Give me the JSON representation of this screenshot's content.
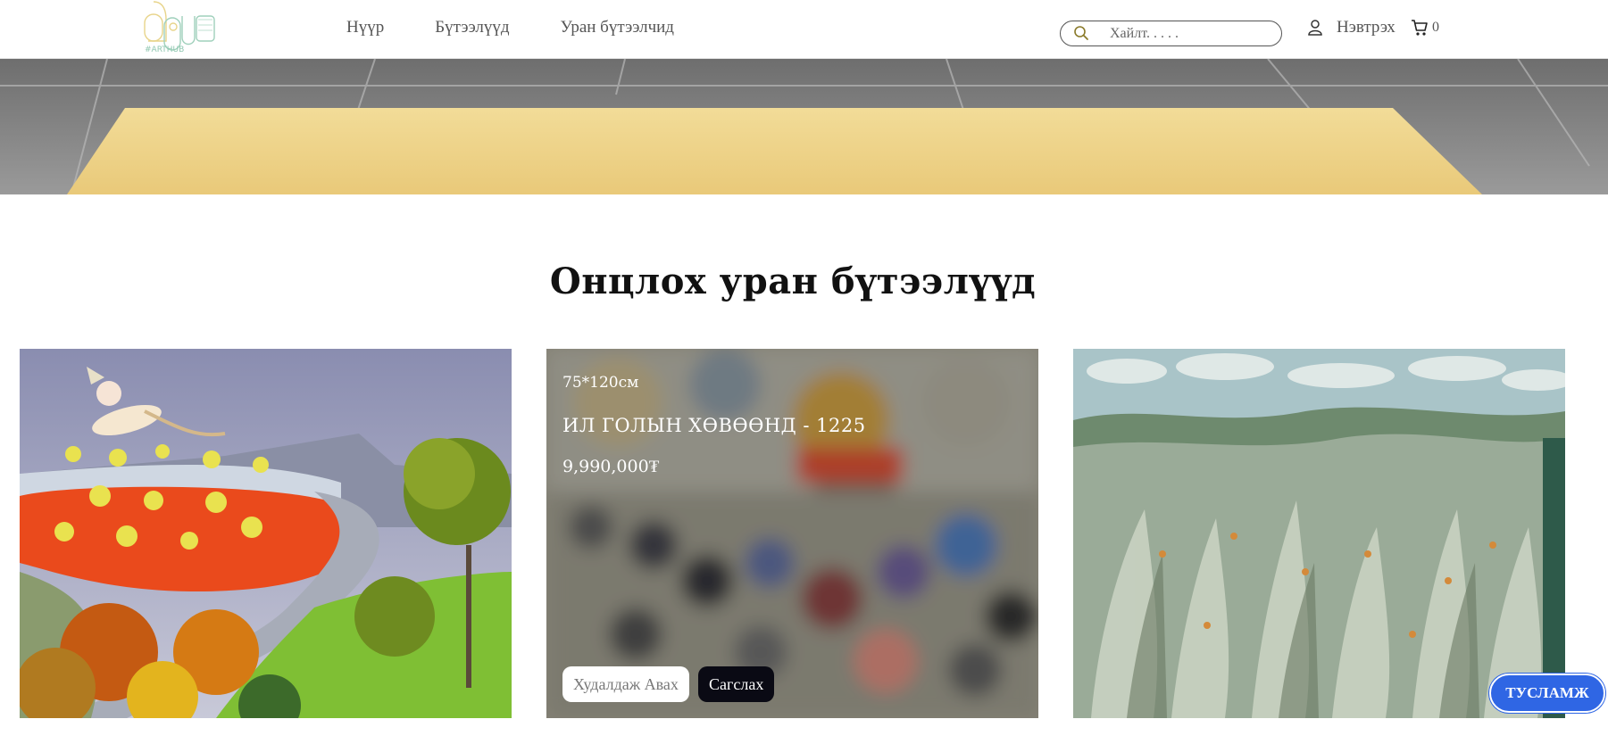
{
  "header": {
    "logo_text": "#ARTHUB",
    "nav": [
      {
        "label": "Нүүр"
      },
      {
        "label": "Бүтээлүүд"
      },
      {
        "label": "Уран бүтээлчид"
      }
    ],
    "search": {
      "placeholder": "Хайлт. . . . ."
    },
    "login_label": "Нэвтрэх",
    "cart_count": "0"
  },
  "section": {
    "title": "Онцлох уран бүтээлүүд"
  },
  "cards": [
    {
      "image": "landscape-painting-river"
    },
    {
      "image": "painting-festival-blurred",
      "size": "75*120см",
      "title": "ИЛ ГОЛЫН ХӨВӨӨНД - 1225",
      "price": "9,990,000₮",
      "buy_label": "Худалдаж Авах",
      "save_label": "Сагслах"
    },
    {
      "image": "abstract-painting-figures"
    }
  ],
  "help_label": "ТУСЛАМЖ",
  "colors": {
    "accent": "#2f66e4",
    "dark_button": "#0a0a14"
  }
}
